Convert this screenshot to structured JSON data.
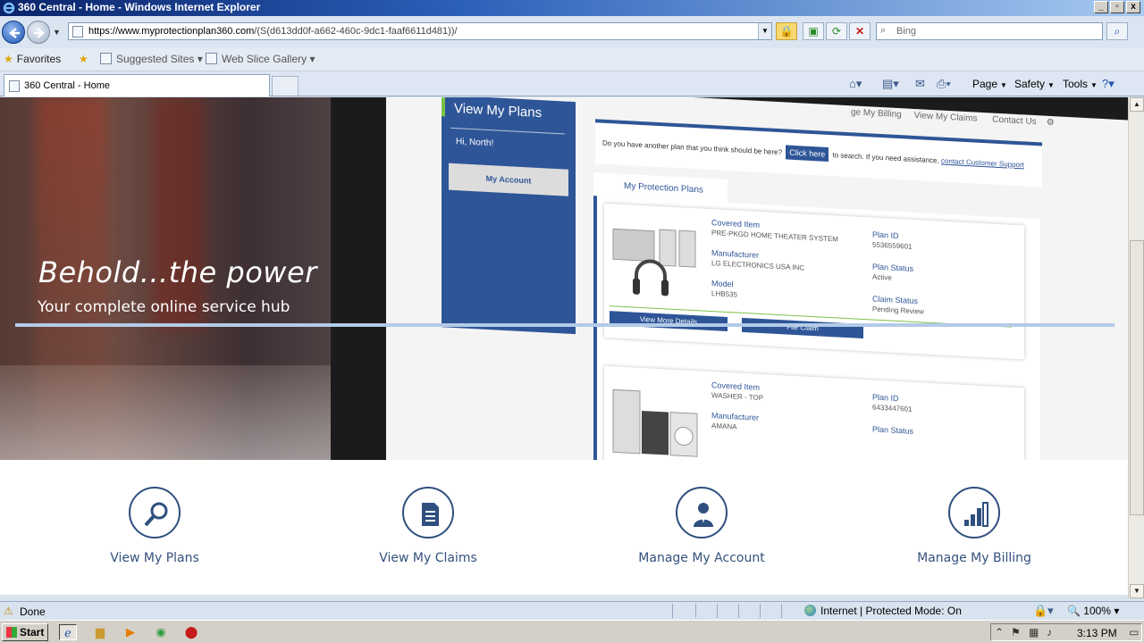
{
  "window": {
    "title": "360 Central - Home - Windows Internet Explorer",
    "controls": {
      "minimize": "_",
      "maximize": "▫",
      "close": "x"
    }
  },
  "address": {
    "url_host": "https://www.myprotectionplan360.com",
    "url_path": "/(S(d613dd0f-a662-460c-9dc1-faaf6611d481))/",
    "search_placeholder": "Bing"
  },
  "favorites": {
    "favorites_label": "Favorites",
    "suggested_sites": "Suggested Sites",
    "web_slice_gallery": "Web Slice Gallery"
  },
  "tabs": [
    {
      "label": "360 Central - Home"
    }
  ],
  "command_bar": {
    "page": "Page",
    "safety": "Safety",
    "tools": "Tools"
  },
  "hero": {
    "title": "Behold...the power",
    "subtitle": "Your complete online service hub",
    "screenshot": {
      "sidebar_title": "View My Plans",
      "greeting": "Hi, North!",
      "my_account": "My Account",
      "top_nav": [
        "ge My Billing",
        "View My Claims",
        "Contact Us"
      ],
      "notice_prefix": "Do you have another plan that you think should be here?",
      "notice_button": "Click here",
      "notice_middle": "to search. If you need assistance,",
      "notice_link": "contact Customer Support",
      "plans_tab": "My Protection Plans",
      "plans": [
        {
          "covered_item_label": "Covered Item",
          "covered_item": "PRE-PKGD HOME THEATER SYSTEM",
          "manufacturer_label": "Manufacturer",
          "manufacturer": "LG ELECTRONICS USA INC",
          "model_label": "Model",
          "model": "LHB535",
          "plan_id_label": "Plan ID",
          "plan_id": "5536559601",
          "plan_status_label": "Plan Status",
          "plan_status": "Active",
          "claim_status_label": "Claim Status",
          "claim_status": "Pending Review",
          "details_button": "View More Details",
          "claim_button": "File Claim"
        },
        {
          "covered_item_label": "Covered Item",
          "covered_item": "WASHER - TOP",
          "manufacturer_label": "Manufacturer",
          "manufacturer": "AMANA",
          "plan_id_label": "Plan ID",
          "plan_id": "6433447601",
          "plan_status_label": "Plan Status"
        }
      ]
    }
  },
  "features": [
    {
      "label": "View My Plans",
      "icon": "magnifier-icon"
    },
    {
      "label": "View My Claims",
      "icon": "document-icon"
    },
    {
      "label": "Manage My Account",
      "icon": "person-icon"
    },
    {
      "label": "Manage My Billing",
      "icon": "bar-chart-icon"
    }
  ],
  "status": {
    "text": "Done",
    "zone": "Internet | Protected Mode: On",
    "zoom": "100%"
  },
  "taskbar": {
    "start": "Start",
    "clock": "3:13 PM"
  },
  "colors": {
    "brand_blue": "#2e5597",
    "feature_text": "#34527e",
    "accent_green": "#7cc24a"
  }
}
